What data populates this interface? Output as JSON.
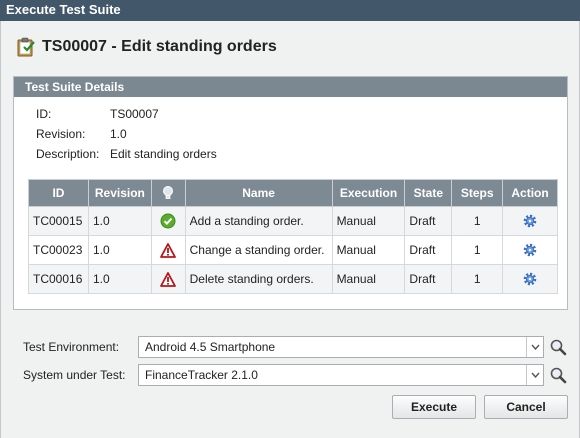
{
  "window": {
    "title": "Execute Test Suite"
  },
  "heading": {
    "title": "TS00007 - Edit standing orders",
    "icon": "clipboard-icon"
  },
  "panel": {
    "title": "Test Suite Details",
    "details": [
      {
        "key": "ID:",
        "value": "TS00007"
      },
      {
        "key": "Revision:",
        "value": "1.0"
      },
      {
        "key": "Description:",
        "value": "Edit standing orders"
      }
    ]
  },
  "table": {
    "columns": [
      "ID",
      "Revision",
      "",
      "Name",
      "Execution",
      "State",
      "Steps",
      "Action"
    ],
    "rows": [
      {
        "id": "TC00015",
        "revision": "1.0",
        "status_icon": "check-icon",
        "name": "Add a standing order.",
        "execution": "Manual",
        "state": "Draft",
        "steps": "1",
        "action_icon": "gear-icon"
      },
      {
        "id": "TC00023",
        "revision": "1.0",
        "status_icon": "warning-icon",
        "name": "Change a standing order.",
        "execution": "Manual",
        "state": "Draft",
        "steps": "1",
        "action_icon": "gear-icon"
      },
      {
        "id": "TC00016",
        "revision": "1.0",
        "status_icon": "warning-icon",
        "name": "Delete standing orders.",
        "execution": "Manual",
        "state": "Draft",
        "steps": "1",
        "action_icon": "gear-icon"
      }
    ]
  },
  "form": {
    "environment_label": "Test Environment:",
    "environment_value": "Android 4.5 Smartphone",
    "system_label": "System under Test:",
    "system_value": "FinanceTracker 2.1.0"
  },
  "buttons": {
    "execute": "Execute",
    "cancel": "Cancel"
  },
  "colors": {
    "titlebar": "#42586a",
    "table_header": "#7d8a93",
    "panel_header": "#7c8891",
    "success": "#5aab2e",
    "warning": "#b8141a",
    "gear": "#3a6fc4"
  }
}
